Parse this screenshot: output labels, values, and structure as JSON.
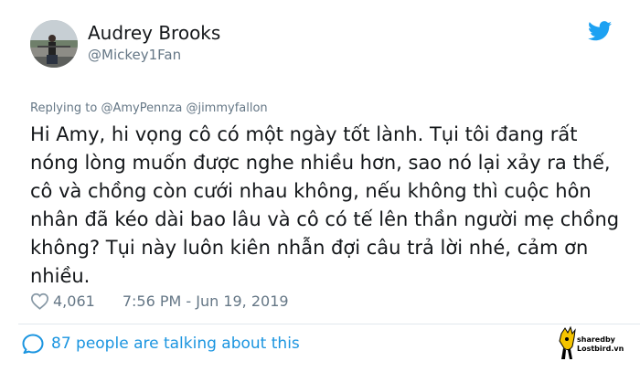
{
  "user": {
    "name": "Audrey Brooks",
    "handle": "@Mickey1Fan"
  },
  "reply": {
    "prefix": "Replying to",
    "mentions": "@AmyPennza @jimmyfallon"
  },
  "tweet": {
    "text": "Hi Amy, hi vọng cô có một ngày tốt lành. Tụi tôi đang rất nóng lòng muốn được nghe nhiều hơn, sao nó lại xảy ra thế, cô và chồng còn cưới nhau không, nếu không thì cuộc hôn nhân đã kéo dài bao lâu và cô có tế lên thần người mẹ chồng không? Tụi này luôn kiên nhẫn đợi câu trả lời nhé, cảm ơn nhiều."
  },
  "meta": {
    "likes": "4,061",
    "timestamp": "7:56 PM - Jun 19, 2019"
  },
  "footer": {
    "talking": "87 people are talking about this"
  },
  "watermark": {
    "line1": "sharedby",
    "line2": "Lostbird.vn"
  },
  "colors": {
    "twitter_blue": "#1da1f2",
    "link_blue": "#1b95e0",
    "muted_gray": "#657786",
    "text": "#14171a"
  },
  "icons": {
    "brand": "twitter-bird-icon",
    "like": "heart-icon",
    "comments": "speech-bubble-icon"
  }
}
